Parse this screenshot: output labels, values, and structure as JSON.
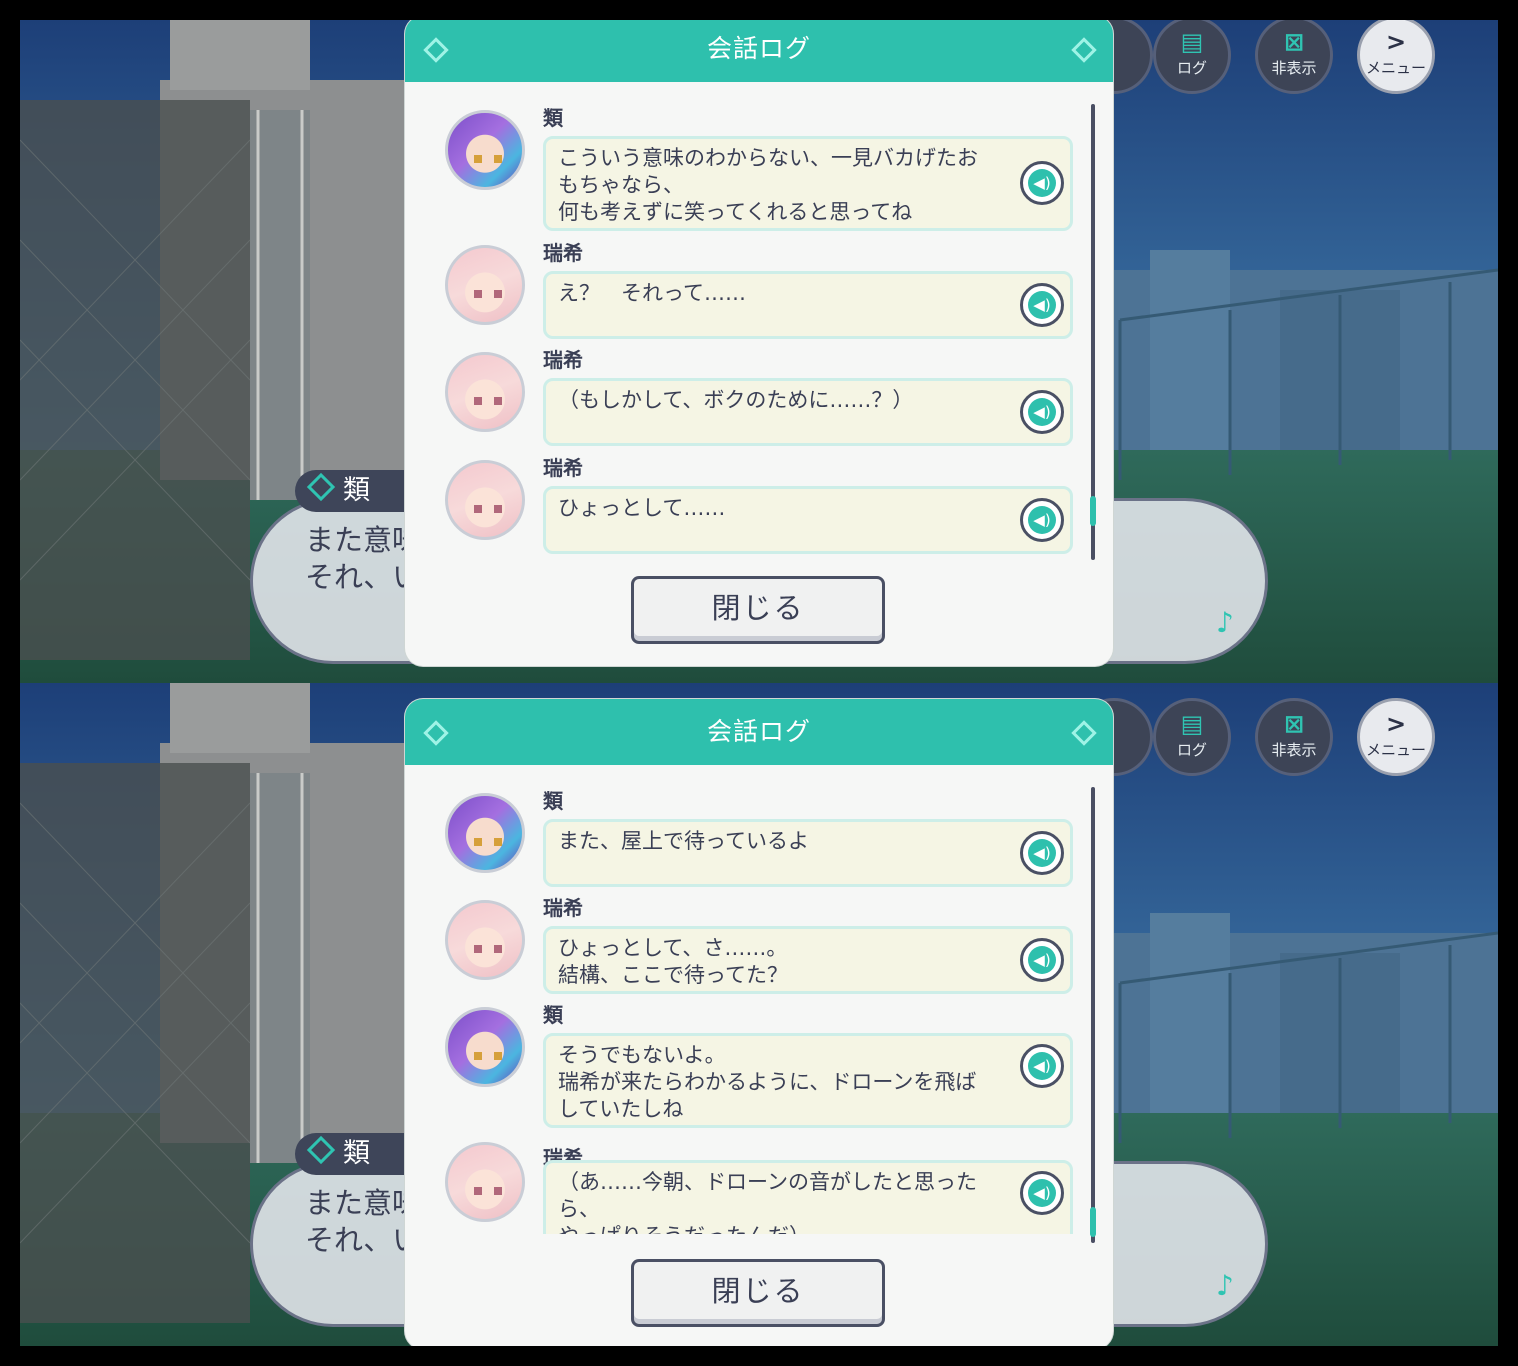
{
  "hud": {
    "log_label": "ログ",
    "hide_label": "非表示",
    "menu_label": "メニュー"
  },
  "background_dialogue": {
    "speaker": "類",
    "text": "また意味\nそれ、い"
  },
  "panels": [
    {
      "dialog_title": "会話ログ",
      "close_label": "閉じる",
      "entries": [
        {
          "speaker": "類",
          "avatar": "rui",
          "text": "こういう意味のわからない、一見バカげたお\nもちゃなら、\n何も考えずに笑ってくれると思ってね"
        },
        {
          "speaker": "瑞希",
          "avatar": "mizuki",
          "text": "え？　それって……"
        },
        {
          "speaker": "瑞希",
          "avatar": "mizuki",
          "text": "（もしかして、ボクのために……？）"
        },
        {
          "speaker": "瑞希",
          "avatar": "mizuki",
          "text": "ひょっとして……"
        }
      ]
    },
    {
      "dialog_title": "会話ログ",
      "close_label": "閉じる",
      "entries": [
        {
          "speaker": "類",
          "avatar": "rui",
          "text": "また、屋上で待っているよ"
        },
        {
          "speaker": "瑞希",
          "avatar": "mizuki",
          "text": "ひょっとして、さ……。\n結構、ここで待ってた？"
        },
        {
          "speaker": "類",
          "avatar": "rui",
          "text": "そうでもないよ。\n瑞希が来たらわかるように、ドローンを飛ば\nしていたしね"
        },
        {
          "speaker": "瑞希",
          "avatar": "mizuki",
          "text": "（あ……今朝、ドローンの音がしたと思った\nら、\nやっぱりそうだったんだ）"
        }
      ]
    }
  ],
  "icons": {
    "voice": "speaker-icon",
    "note": "music-note-icon",
    "log": "log-icon",
    "hide": "hide-icon",
    "menu": "menu-arrow-icon"
  },
  "colors": {
    "accent": "#2ec0ad",
    "dark": "#3a3f55",
    "bubble": "#f5f5e4"
  }
}
